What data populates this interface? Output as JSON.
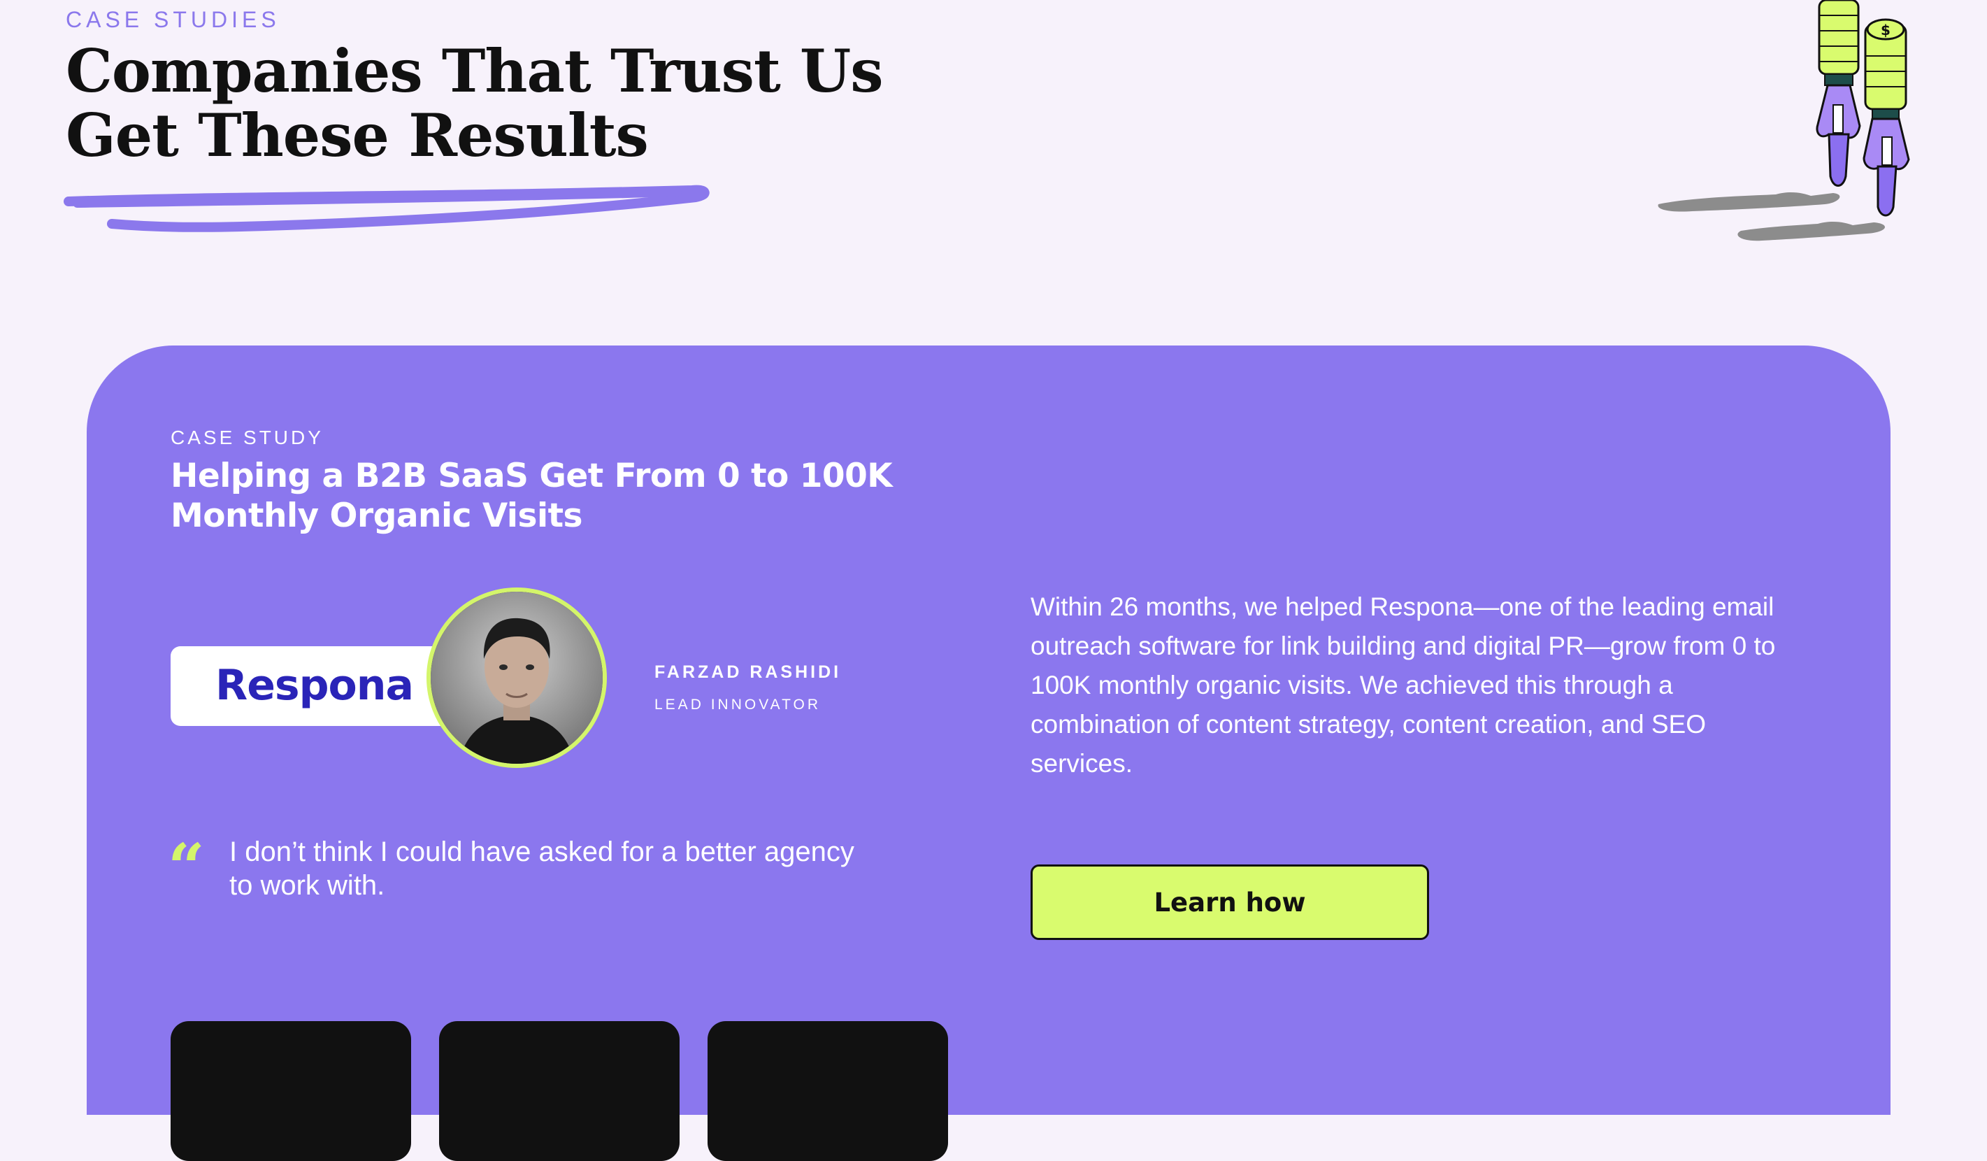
{
  "header": {
    "eyebrow": "CASE STUDIES",
    "title": "Companies That Trust Us Get These Results",
    "accent_color": "#8b78ec"
  },
  "case_study": {
    "eyebrow": "CASE STUDY",
    "title": "Helping a B2B SaaS Get From 0 to 100K Monthly Organic Visits",
    "client_logo_text": "Respona",
    "person": {
      "name": "FARZAD RASHIDI",
      "role": "LEAD INNOVATOR"
    },
    "quote_mark": "“",
    "quote": "I don’t think I could have asked for a better agency to work with.",
    "description": "Within 26 months, we helped Respona—one of the leading email outreach software for link building and digital PR—grow from 0 to 100K monthly organic visits. We achieved this through a combination of content strategy, content creation, and SEO services.",
    "cta_label": "Learn how",
    "card_color": "#8b77ee",
    "cta_color": "#d9fb6e",
    "highlight_color": "#d4f56b"
  },
  "stat_cards": [
    {
      "id": "stat-card-1"
    },
    {
      "id": "stat-card-2"
    },
    {
      "id": "stat-card-3"
    }
  ],
  "icons": {
    "decoration": "coin-rocket-icon",
    "underline": "brush-underline-icon",
    "avatar": "person-photo-icon"
  }
}
